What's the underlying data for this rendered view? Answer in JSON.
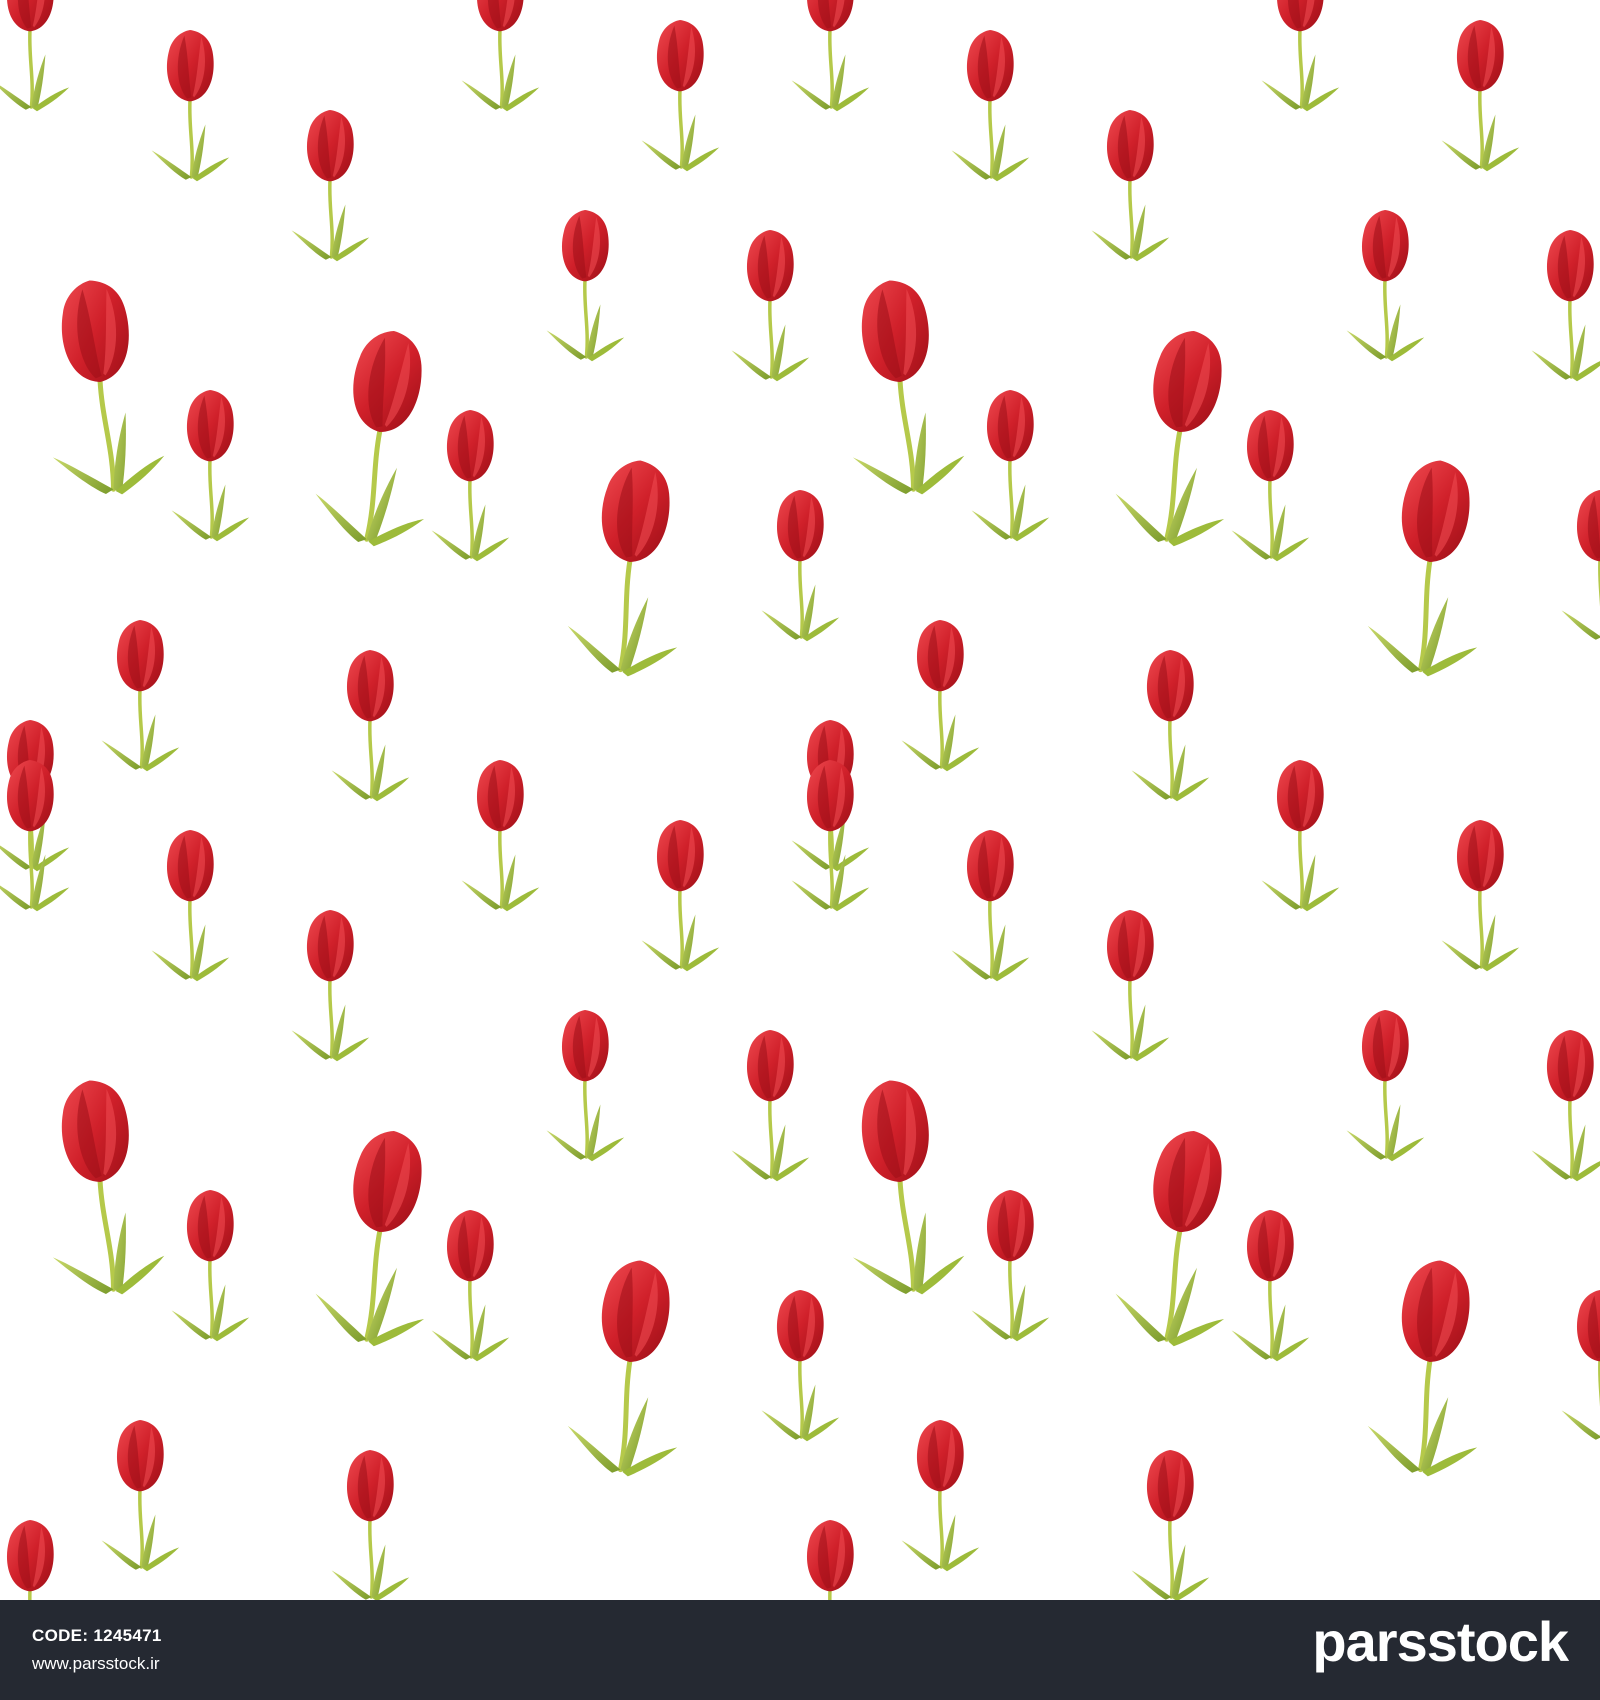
{
  "scene": {
    "subject": "red-tulips-seamless-pattern",
    "colors": {
      "background": "#ffffff",
      "petal": "#d0202a",
      "petal_dark": "#9c0f17",
      "petal_highlight": "#ef4a50",
      "stem": "#b5c94a",
      "leaf": "#9dbb3a",
      "leaf_dark": "#7a9a2a",
      "footer": "#252932"
    }
  },
  "footer": {
    "code_label": "CODE:",
    "code_value": "1245471",
    "url": "www.parsstock.ir",
    "brand": "parsstock"
  }
}
